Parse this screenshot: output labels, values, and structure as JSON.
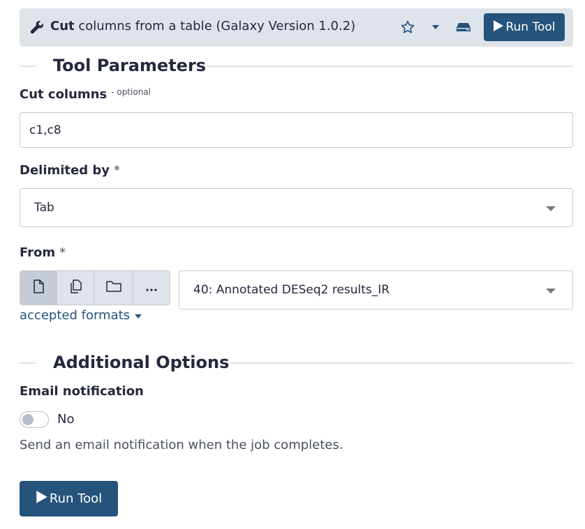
{
  "header": {
    "tool_name": "Cut",
    "tool_description": "columns from a table (Galaxy Version 1.0.2)",
    "run_label": "Run Tool",
    "icons": [
      "wrench-icon",
      "star-icon",
      "caret-down-icon",
      "hdd-icon",
      "play-icon"
    ]
  },
  "sections": {
    "tool_parameters": "Tool Parameters",
    "additional_options": "Additional Options"
  },
  "params": {
    "cut_columns": {
      "label": "Cut columns",
      "optional": "- optional",
      "value": "c1,c8"
    },
    "delimited_by": {
      "label": "Delimited by",
      "required": "*",
      "value": "Tab"
    },
    "from": {
      "label": "From",
      "required": "*",
      "value": "40: Annotated DESeq2 results_IR",
      "source_buttons": [
        "single-dataset-icon",
        "multiple-datasets-icon",
        "dataset-collection-icon",
        "more-options-icon"
      ],
      "accepted_formats": "accepted formats"
    }
  },
  "email": {
    "label": "Email notification",
    "toggle_label": "No",
    "enabled": false,
    "help": "Send an email notification when the job completes."
  },
  "footer": {
    "run_label": "Run Tool"
  },
  "colors": {
    "primary": "#25537b",
    "header_bg": "#dfe3ea",
    "text": "#25283d",
    "border": "#c5cad3"
  }
}
